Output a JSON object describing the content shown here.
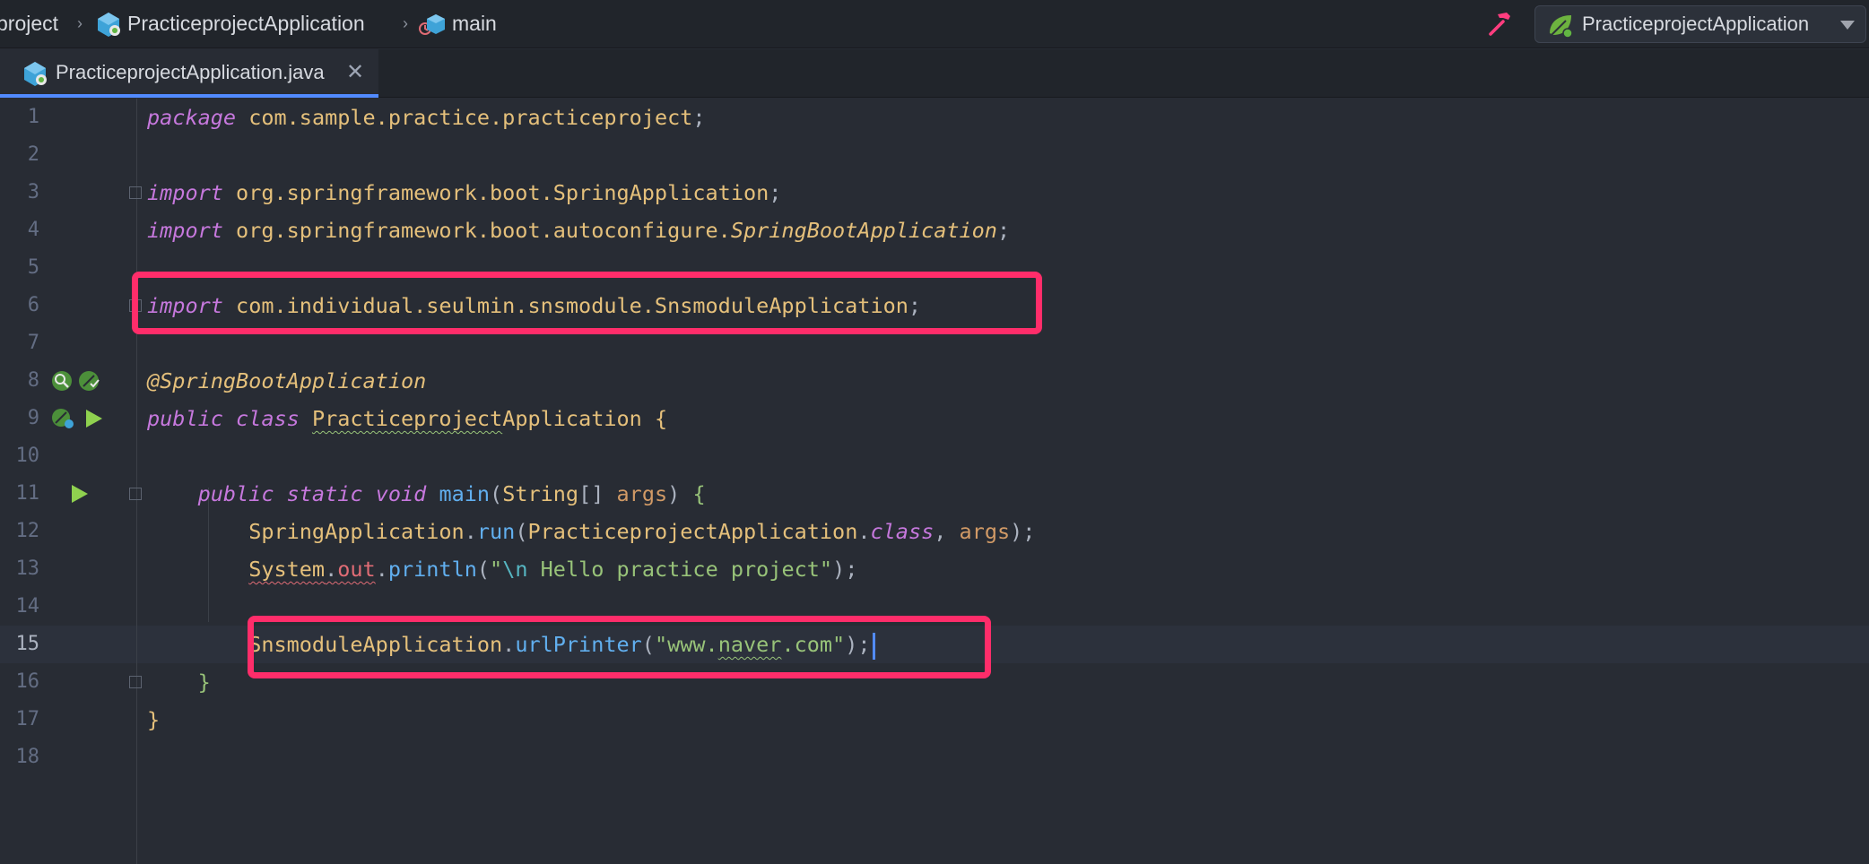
{
  "navbar": {
    "crumbs": [
      "project",
      "PracticeprojectApplication",
      "main"
    ],
    "run_config": "PracticeprojectApplication"
  },
  "tab": {
    "label": "PracticeprojectApplication.java",
    "close_glyph": "✕"
  },
  "editor": {
    "active_line": 15,
    "line_numbers": [
      "1",
      "2",
      "3",
      "4",
      "5",
      "6",
      "7",
      "8",
      "9",
      "10",
      "11",
      "12",
      "13",
      "14",
      "15",
      "16",
      "17",
      "18"
    ],
    "tokens": {
      "package_kw": "package",
      "package_name": "com.sample.practice.practiceproject",
      "semi": ";",
      "import_kw": "import",
      "import1": "org.springframework.boot.SpringApplication",
      "import2_prefix": "org.springframework.boot.autoconfigure.",
      "import2_class": "SpringBootApplication",
      "import3": "com.individual.seulmin.snsmodule.SnsmoduleApplication",
      "annotation": "@SpringBootApplication",
      "public_kw": "public",
      "class_kw": "class",
      "class_name_a": "Practiceproject",
      "class_name_b": "Application",
      "open_brace": "{",
      "close_brace": "}",
      "static_kw": "static",
      "void_kw": "void",
      "main_fn": "main",
      "string_type": "String",
      "array_brackets": "[]",
      "args": "args",
      "spring_app": "SpringApplication",
      "run_fn": "run",
      "app_class": "PracticeprojectApplication",
      "class_literal": "class",
      "system": "System",
      "out": "out",
      "println": "println",
      "quote": "\"",
      "escape_n": "\\n",
      "hello_text": " Hello practice project",
      "sns_app": "SnsmoduleApplication",
      "url_printer": "urlPrinter",
      "url_a": "www.",
      "url_b": "naver",
      "url_c": ".com"
    }
  }
}
